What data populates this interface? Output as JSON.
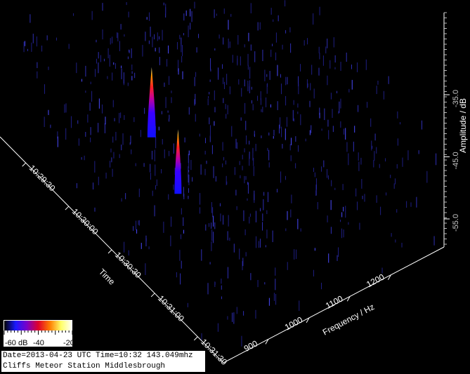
{
  "chart_data": {
    "type": "3d-waterfall-spectrogram",
    "title": "",
    "time_axis": {
      "label": "Time",
      "ticks": [
        "10:29:30",
        "10:30:00",
        "10:30:30",
        "10:31:00",
        "10:31:30"
      ]
    },
    "frequency_axis": {
      "label": "Frequency / Hz",
      "ticks": [
        900,
        1000,
        1100,
        1200
      ]
    },
    "amplitude_axis": {
      "label": "Amplitude / dB",
      "ticks": [
        -35.0,
        -45.0,
        -55.0
      ],
      "tick_labels": [
        "-35.0",
        "-45.0",
        "-55.0"
      ]
    },
    "color_scale": {
      "labels": [
        "-60 dB",
        "-40",
        "-20"
      ],
      "colors": [
        "#000000",
        "#1a1aff",
        "#7a00c8",
        "#e0002a",
        "#ff7a00",
        "#ffff66",
        "#ffffff"
      ]
    },
    "meteor_events": [
      {
        "time": "10:29:58",
        "frequency": 1000,
        "peak_amplitude_db": -37
      },
      {
        "time": "10:30:05",
        "frequency": 1040,
        "peak_amplitude_db": -47
      }
    ],
    "background_color": "#000000",
    "noise_color": "#2a2aa8"
  },
  "caption": {
    "line1": "Date=2013-04-23 UTC Time=10:32 143.049mhz",
    "line2": "Cliffs Meteor Station Middlesbrough"
  }
}
